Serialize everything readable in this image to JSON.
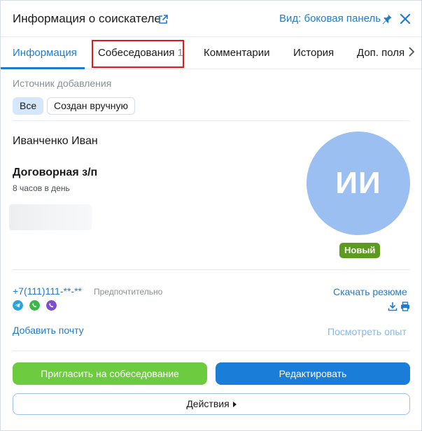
{
  "header": {
    "title": "Информация о соискателе",
    "view_link": "Вид: боковая панель"
  },
  "tabs": [
    {
      "label": "Информация",
      "active": true
    },
    {
      "label": "Собеседования",
      "count": "1"
    },
    {
      "label": "Комментарии"
    },
    {
      "label": "История"
    },
    {
      "label": "Доп. поля"
    }
  ],
  "source": {
    "label": "Источник добавления",
    "chips": [
      "Все",
      "Создан вручную"
    ],
    "selected": "Все"
  },
  "candidate": {
    "name": "Иванченко Иван",
    "salary": "Договорная з/п",
    "schedule": "8 часов в день",
    "initials": "ИИ",
    "status": "Новый"
  },
  "contacts": {
    "phone": "+7(111)111-**-**",
    "preferred": "Предпочтительно",
    "messengers": [
      "telegram-icon",
      "whatsapp-icon",
      "viber-icon"
    ],
    "download_resume": "Скачать резюме",
    "add_email": "Добавить почту",
    "view_experience": "Посмотреть опыт"
  },
  "actions": {
    "invite": "Пригласить на собеседование",
    "edit": "Редактировать",
    "more": "Действия"
  },
  "colors": {
    "accent": "#1f7ccc",
    "invite_button": "#6dcb3f",
    "edit_button": "#1a7ed8",
    "avatar": "#9cbff2",
    "status_badge": "#5c9a20",
    "tab_highlight": "#e01818"
  }
}
